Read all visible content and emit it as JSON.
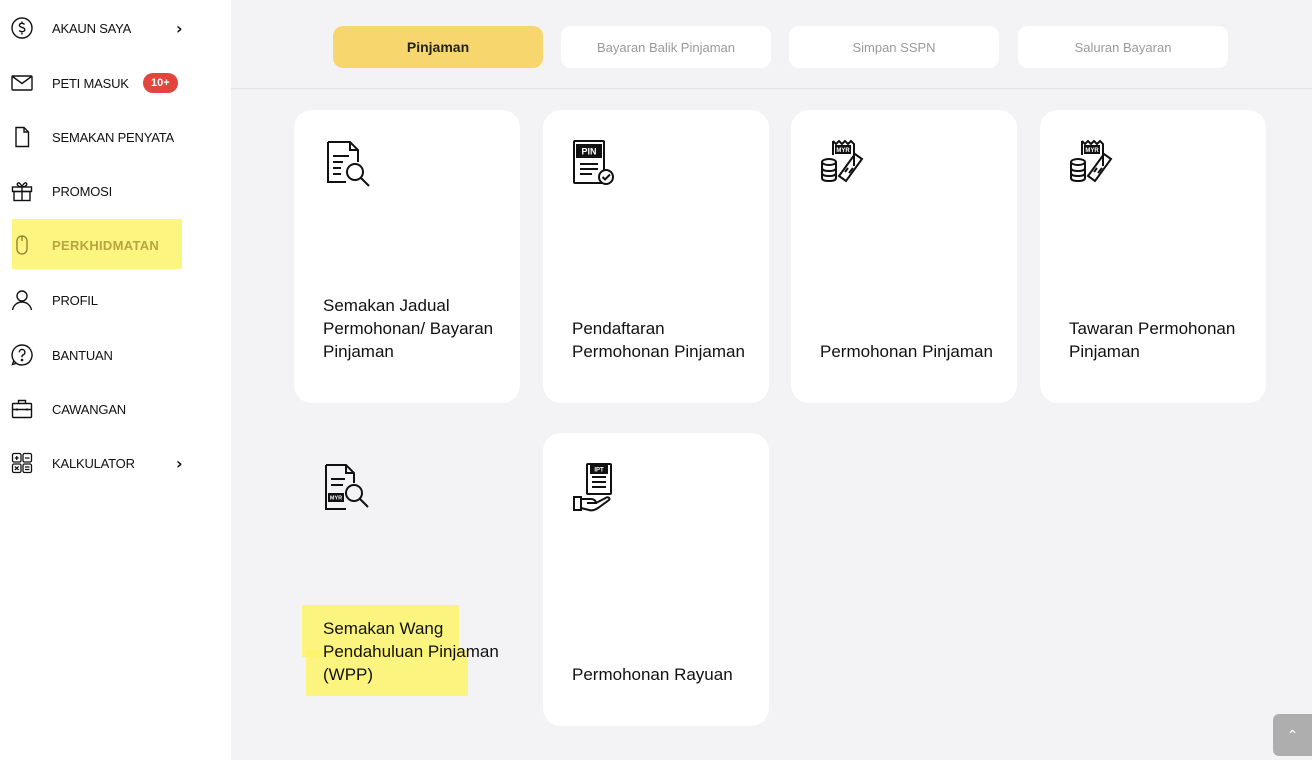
{
  "sidebar": {
    "items": [
      {
        "label": "AKAUN SAYA",
        "icon": "dollar-circle-icon",
        "chevron": "›"
      },
      {
        "label": "PETI MASUK",
        "icon": "envelope-icon",
        "badge": "10+"
      },
      {
        "label": "SEMAKAN PENYATA",
        "icon": "document-icon"
      },
      {
        "label": "PROMOSI",
        "icon": "gift-icon"
      },
      {
        "label": "PERKHIDMATAN",
        "icon": "mouse-icon",
        "active": true
      },
      {
        "label": "PROFIL",
        "icon": "user-icon"
      },
      {
        "label": "BANTUAN",
        "icon": "help-circle-icon"
      },
      {
        "label": "CAWANGAN",
        "icon": "briefcase-icon"
      },
      {
        "label": "KALKULATOR",
        "icon": "calculator-icon",
        "chevron": "›"
      }
    ]
  },
  "tabs": [
    {
      "label": "Pinjaman",
      "active": true
    },
    {
      "label": "Bayaran Balik Pinjaman"
    },
    {
      "label": "Simpan SSPN"
    },
    {
      "label": "Saluran Bayaran"
    }
  ],
  "cards": [
    {
      "label": "Semakan Jadual Permohonan/ Bayaran Pinjaman",
      "icon": "document-search-icon"
    },
    {
      "label": "Pendaftaran Permohonan Pinjaman",
      "icon": "pin-document-icon",
      "icon_text": "PIN"
    },
    {
      "label": "Permohonan Pinjaman",
      "icon": "myr-receipt-coins-icon",
      "icon_text": "MYR"
    },
    {
      "label": "Tawaran Permohonan Pinjaman",
      "icon": "myr-receipt-coins-icon",
      "icon_text": "MYR"
    },
    {
      "label": "Semakan Wang Pendahuluan Pinjaman (WPP)",
      "icon": "myr-document-search-icon",
      "icon_text": "MYR"
    },
    {
      "label": "Permohonan Rayuan",
      "icon": "ipt-document-hand-icon",
      "icon_text": "IPT"
    }
  ],
  "scroll_top": {
    "icon": "chevron-up-icon",
    "glyph": "⌃"
  },
  "colors": {
    "accent": "#f8d66e",
    "badge": "#e0463c",
    "highlighter": "#fbf36a",
    "background": "#f3f3f5"
  }
}
